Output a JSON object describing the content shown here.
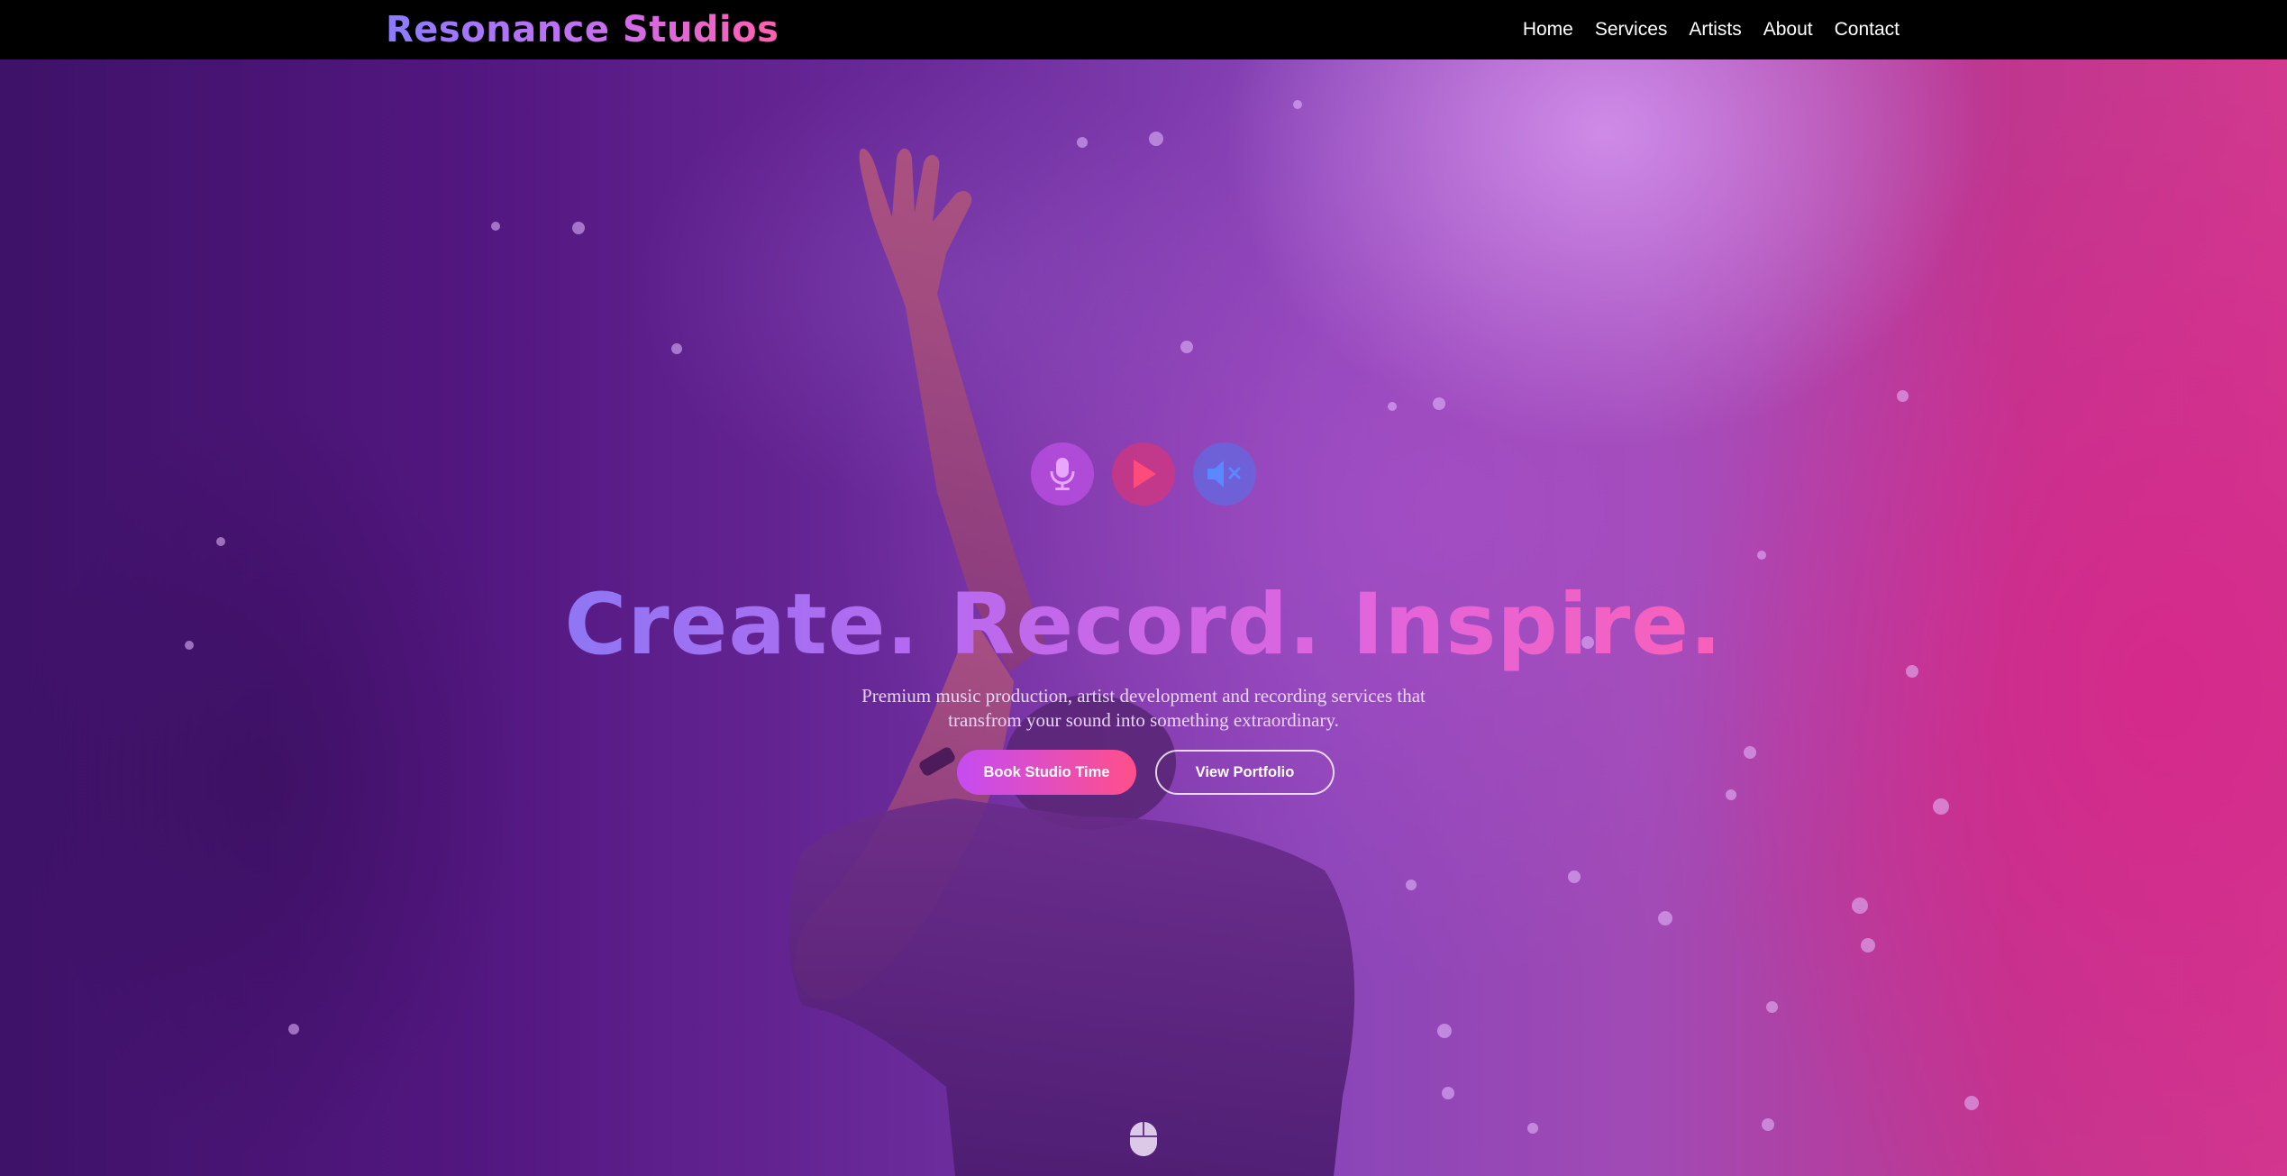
{
  "brand": {
    "name": "Resonance Studios"
  },
  "nav": {
    "items": [
      {
        "label": "Home"
      },
      {
        "label": "Services"
      },
      {
        "label": "Artists"
      },
      {
        "label": "About"
      },
      {
        "label": "Contact"
      }
    ]
  },
  "hero": {
    "icons": [
      "microphone-icon",
      "play-icon",
      "mute-icon"
    ],
    "headline": {
      "words": [
        "Create.",
        "Record.",
        "Inspire."
      ]
    },
    "subtext": {
      "line1": "Premium music production, artist development and recording services that",
      "line2": "transfrom your sound into something extraordinary."
    },
    "buttons": {
      "primary": "Book Studio Time",
      "secondary": "View Portfolio"
    },
    "scroll_icon": "mouse-icon"
  },
  "colors": {
    "nav_bg": "#000000",
    "accent_purple": "#c54cf2",
    "accent_pink": "#ff4f8a",
    "accent_blue": "#4d86ff"
  }
}
